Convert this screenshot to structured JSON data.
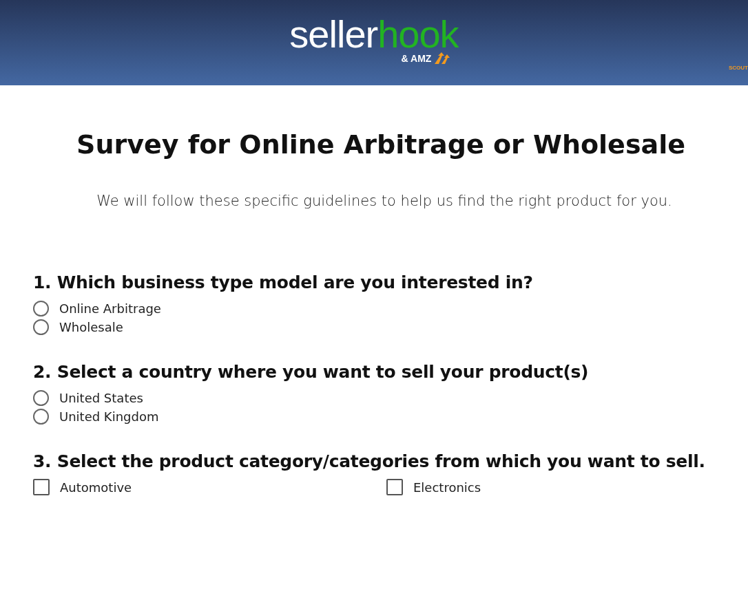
{
  "header": {
    "logo_primary": "seller",
    "logo_accent": "hook",
    "partner": "& AMZ",
    "partner_sub": "SCOUT"
  },
  "title": "Survey for Online Arbitrage or Wholesale",
  "intro": "We will follow these specific guidelines to help us find the right product for you.",
  "questions": [
    {
      "kind": "radio",
      "label": "1. Which business type model are you interested in?",
      "options": [
        {
          "label": "Online Arbitrage",
          "selected": false
        },
        {
          "label": "Wholesale",
          "selected": false
        }
      ]
    },
    {
      "kind": "radio",
      "label": "2. Select a country where you want to sell your product(s)",
      "options": [
        {
          "label": "United States",
          "selected": false
        },
        {
          "label": "United Kingdom",
          "selected": false
        }
      ]
    },
    {
      "kind": "checkbox",
      "label": "3. Select the product category/categories from which you want to sell.",
      "options": [
        {
          "label": "Automotive",
          "checked": false
        },
        {
          "label": "Electronics",
          "checked": false
        }
      ]
    }
  ]
}
